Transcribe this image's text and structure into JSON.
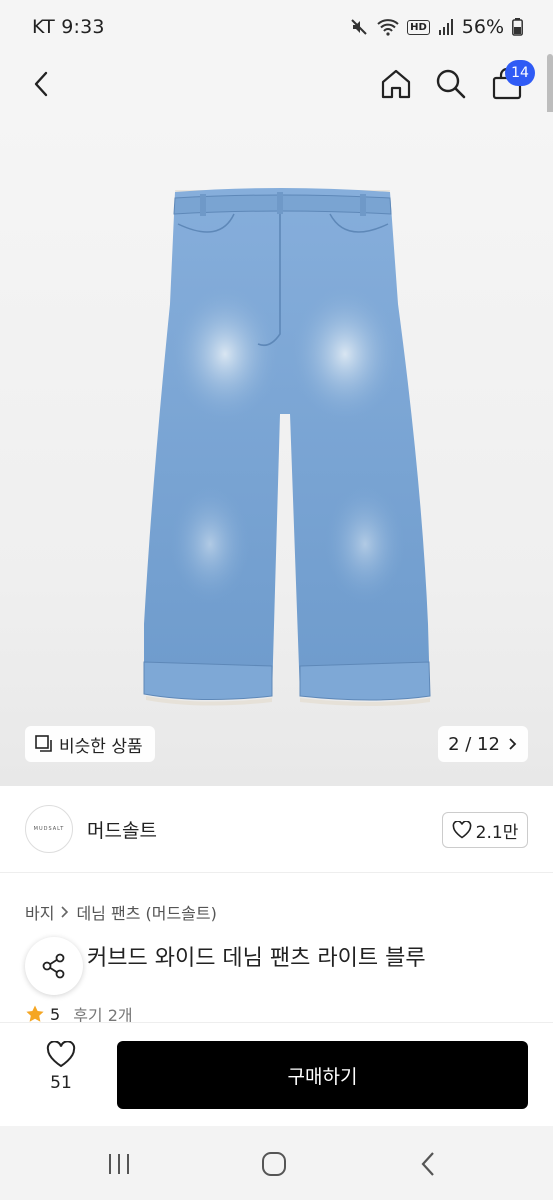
{
  "status_bar": {
    "carrier_time": "KT 9:33",
    "hd": "HD",
    "battery": "56%"
  },
  "top_nav": {
    "cart_count": "14"
  },
  "hero": {
    "similar_label": "비슷한 상품",
    "page_indicator": "2 / 12",
    "denim_color": "#7fa9d6"
  },
  "brand": {
    "logo_text": "MUDSALT",
    "name": "머드솔트",
    "likes": "2.1만"
  },
  "product": {
    "breadcrumb": [
      "바지",
      "데님 팬츠 (머드솔트)"
    ],
    "title": "커브드 와이드 데님 팬츠 라이트 블루",
    "rating": "5",
    "reviews": "후기 2개"
  },
  "purchase": {
    "wish_count": "51",
    "buy_label": "구매하기"
  },
  "colors": {
    "accent": "#2f5bf5",
    "star": "#f5a623",
    "buy_button": "#000000"
  }
}
